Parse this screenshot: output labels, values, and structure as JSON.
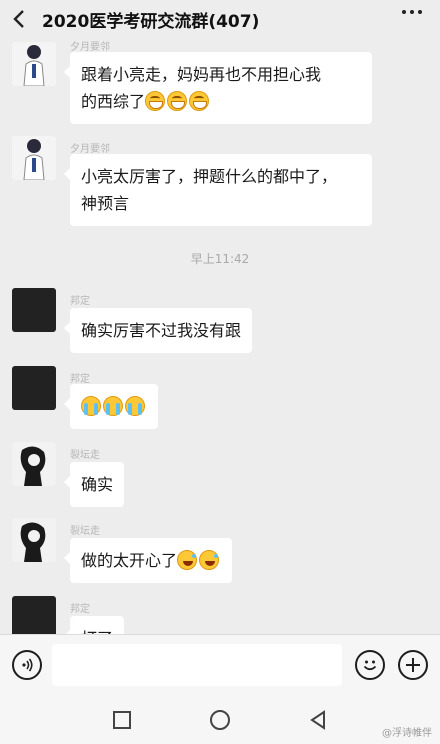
{
  "header": {
    "title": "2020医学考研交流群(407)"
  },
  "messages": [
    {
      "avatar": "doctor-avatar",
      "sender": "夕月要邻",
      "parts": [
        "跟着小亮走，妈妈再也不用担心我",
        "的西综了"
      ],
      "emoji": [
        "grin",
        "grin",
        "grin"
      ]
    },
    {
      "avatar": "doctor-avatar",
      "sender": "夕月要邻",
      "parts": [
        "小亮太厉害了，押题什么的都中了，",
        "神预言"
      ],
      "emoji": []
    },
    {
      "avatar": "dark-avatar",
      "sender": "邦定",
      "parts": [
        "确实厉害不过我没有跟"
      ],
      "emoji": []
    },
    {
      "avatar": "dark-avatar",
      "sender": "邦定",
      "parts": [],
      "emoji": [
        "cry",
        "cry",
        "cry"
      ]
    },
    {
      "avatar": "sketch-avatar",
      "sender": "裂坛走",
      "parts": [
        "确实"
      ],
      "emoji": []
    },
    {
      "avatar": "sketch-avatar",
      "sender": "裂坛走",
      "parts": [
        "做的太开心了"
      ],
      "emoji": [
        "laugh",
        "laugh"
      ]
    },
    {
      "avatar": "dark-avatar",
      "sender": "邦定",
      "parts": [
        "打了"
      ],
      "emoji": []
    }
  ],
  "timestamp": "早上11:42",
  "input": {
    "placeholder": ""
  },
  "watermark": "@浮诗帷伴",
  "colors": {
    "background": "#ededed",
    "bubble": "#ffffff",
    "bar": "#f6f6f6"
  }
}
